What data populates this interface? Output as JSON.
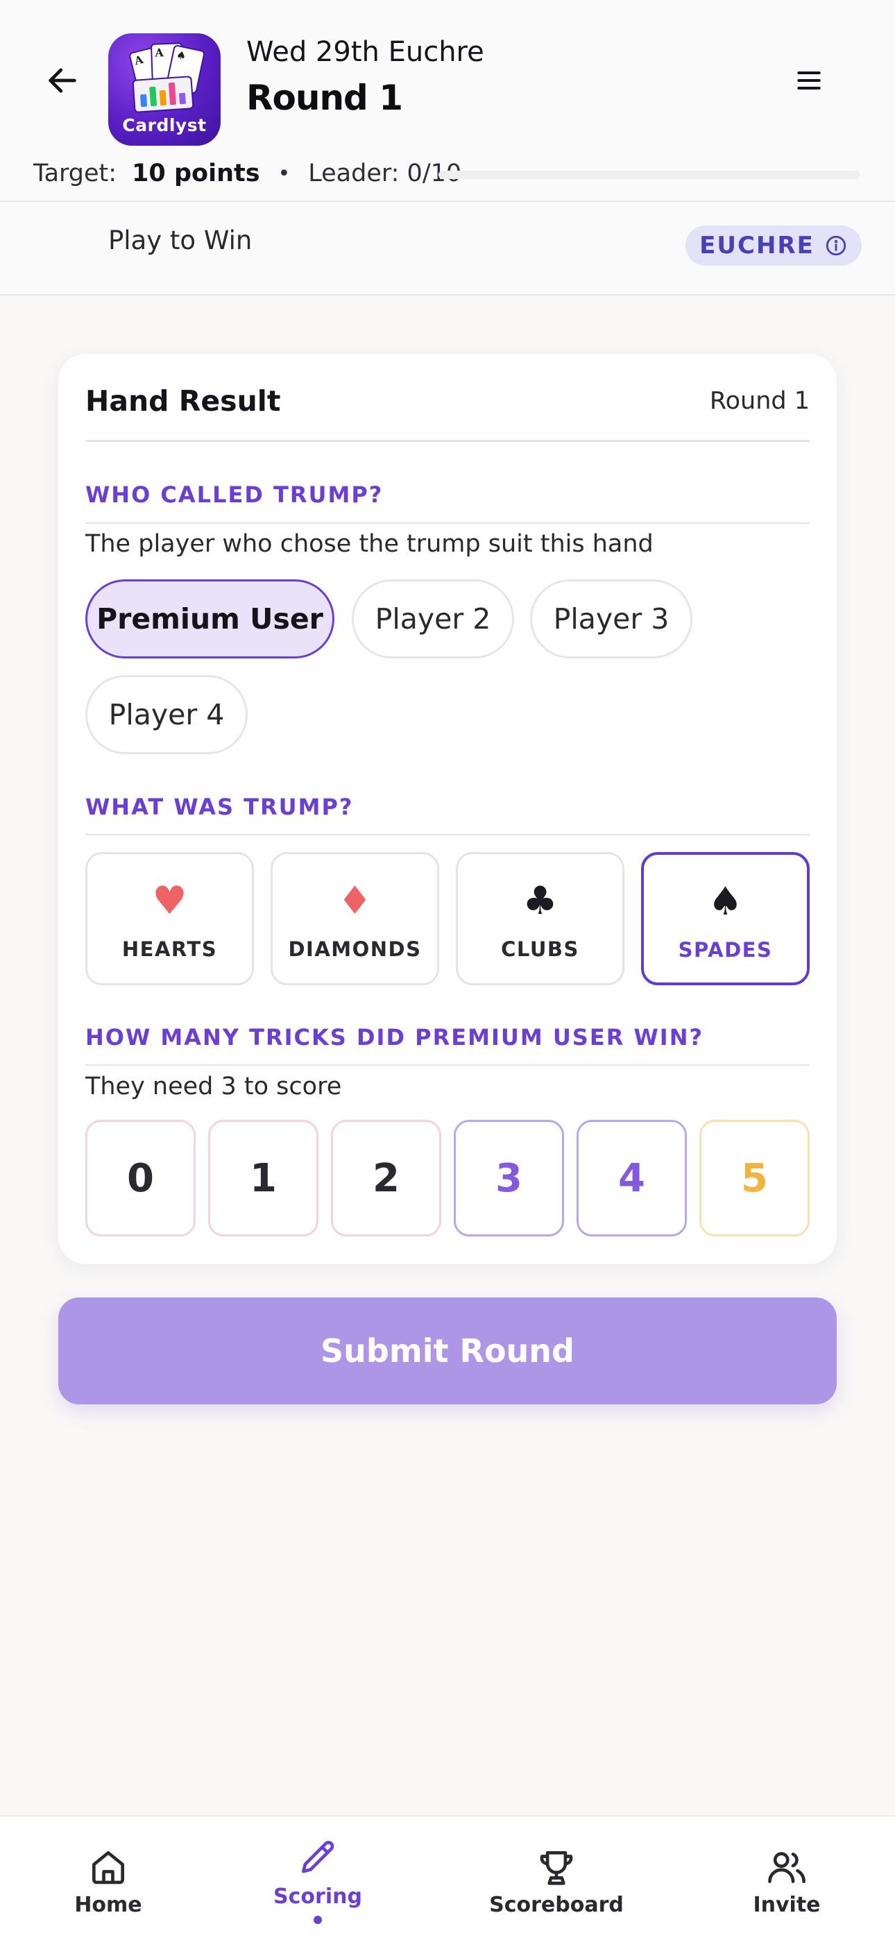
{
  "header": {
    "game_title": "Wed 29th Euchre",
    "round_title": "Round 1",
    "app_icon_label": "Cardlyst",
    "target_label": "Target:",
    "target_value": "10 points",
    "separator": "•",
    "leader_text": "Leader: 0/10",
    "leader_progress": 0
  },
  "mode": {
    "label": "Play to Win",
    "badge": "EUCHRE"
  },
  "hand_card": {
    "title": "Hand Result",
    "round": "Round 1",
    "trump_caller": {
      "title": "WHO CALLED TRUMP?",
      "subtitle": "The player who chose the trump suit this hand",
      "players": [
        "Premium User",
        "Player 2",
        "Player 3",
        "Player 4"
      ],
      "selected": "Premium User"
    },
    "trump_suit": {
      "title": "WHAT WAS TRUMP?",
      "suits": [
        {
          "symbol": "♥",
          "name": "HEARTS",
          "color": "#ee6464"
        },
        {
          "symbol": "♦",
          "name": "DIAMONDS",
          "color": "#ee6464"
        },
        {
          "symbol": "♣",
          "name": "CLUBS",
          "color": "#1c1b22"
        },
        {
          "symbol": "♠",
          "name": "SPADES",
          "color": "#1c1b22"
        }
      ],
      "selected": "SPADES"
    },
    "tricks": {
      "title": "HOW MANY TRICKS DID PREMIUM USER WIN?",
      "subtitle": "They need 3 to score",
      "options": [
        "0",
        "1",
        "2",
        "3",
        "4",
        "5"
      ]
    }
  },
  "submit_label": "Submit Round",
  "nav": {
    "items": [
      {
        "label": "Home",
        "icon": "home-icon"
      },
      {
        "label": "Scoring",
        "icon": "pencil-icon"
      },
      {
        "label": "Scoreboard",
        "icon": "trophy-icon"
      },
      {
        "label": "Invite",
        "icon": "users-icon"
      }
    ],
    "active": "Scoring"
  },
  "colors": {
    "accent": "#6a3fd1",
    "submit": "#ad96e6",
    "badge_bg": "#e3e2f8"
  }
}
